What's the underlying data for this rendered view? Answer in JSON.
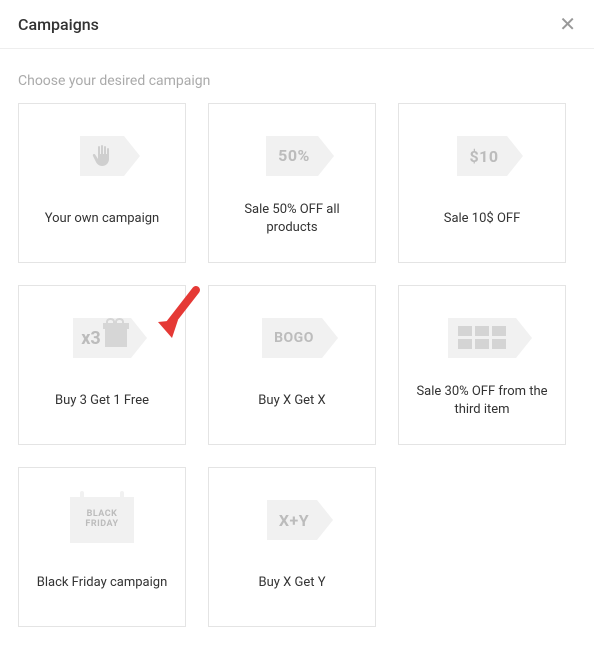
{
  "header": {
    "title": "Campaigns"
  },
  "subtitle": "Choose your desired campaign",
  "cards": [
    {
      "tag_label": "",
      "title": "Your own campaign"
    },
    {
      "tag_label": "50%",
      "title": "Sale 50% OFF all products"
    },
    {
      "tag_label": "$10",
      "title": "Sale 10$ OFF"
    },
    {
      "tag_label": "x3",
      "title": "Buy 3 Get 1 Free"
    },
    {
      "tag_label": "BOGO",
      "title": "Buy X Get X"
    },
    {
      "tag_label": "",
      "title": "Sale 30% OFF from the third item"
    },
    {
      "tag_label_line1": "BLACK",
      "tag_label_line2": "FRIDAY",
      "title": "Black Friday campaign"
    },
    {
      "tag_label": "X+Y",
      "title": "Buy X Get Y"
    }
  ]
}
